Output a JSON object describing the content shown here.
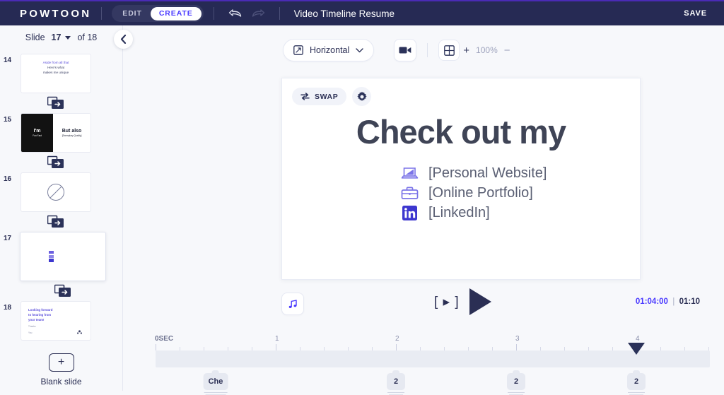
{
  "topbar": {
    "brand": "POWTOON",
    "modes": [
      {
        "label": "EDIT",
        "active": false
      },
      {
        "label": "CREATE",
        "active": true
      }
    ],
    "undo_icon": "undo-icon",
    "redo_icon": "redo-icon",
    "doc_title": "Video Timeline Resume",
    "save_label": "SAVE",
    "bg_color": "#262a54",
    "accent_color": "#4a3aff"
  },
  "sidebar": {
    "slide_label": "Slide",
    "current_slide": "17",
    "of_label": "of 18",
    "collapse_icon": "chevron-left-icon",
    "thumbs": [
      {
        "number": "14",
        "selected": false,
        "kind": "text",
        "line1": "Aside from all that",
        "line2": "Here's what",
        "line3": "makes me unique"
      },
      {
        "number": "15",
        "selected": false,
        "kind": "split",
        "left_big": "I'm",
        "left_small": "Fun Fact",
        "right_big": "But also",
        "right_small": "[Exemplary Quality]"
      },
      {
        "number": "16",
        "selected": false,
        "kind": "circle"
      },
      {
        "number": "17",
        "selected": true,
        "kind": "links",
        "marker": "[Li]"
      },
      {
        "number": "18",
        "selected": false,
        "kind": "outro",
        "head1": "Looking forward",
        "head2": "to hearing from",
        "head3": "your team!",
        "sub1": "Thanks",
        "sub2": "You"
      }
    ],
    "transition_icon": "transition-icon",
    "blank_slide": {
      "plus_icon": "plus-icon",
      "label": "Blank slide"
    }
  },
  "toolbar": {
    "orientation_icon": "resize-icon",
    "orientation_label": "Horizontal",
    "orientation_caret": "chevron-down-icon",
    "record_icon": "video-camera-icon",
    "zoom_grid_icon": "grid-icon",
    "zoom_in_label": "+",
    "zoom_level": "100%",
    "zoom_out_label": "−"
  },
  "canvas": {
    "swap_icon": "swap-arrows-icon",
    "swap_label": "SWAP",
    "settings_icon": "gear-icon",
    "title": "Check out my",
    "links": [
      {
        "icon": "laptop-icon",
        "label": "[Personal Website]"
      },
      {
        "icon": "briefcase-icon",
        "label": "[Online Portfolio]"
      },
      {
        "icon": "linkedin-icon",
        "label": "[LinkedIn]"
      }
    ]
  },
  "playback": {
    "music_icon": "music-note-icon",
    "preview_label": "[ ▸ ]",
    "play_icon": "play-icon",
    "current_time": "01:04:00",
    "divider": "|",
    "total_time": "01:10"
  },
  "timeline": {
    "ruler_labels": [
      "0SEC",
      "1",
      "2",
      "3",
      "4"
    ],
    "playhead_position_sec": 4,
    "playhead_icon": "playhead-marker",
    "clips": [
      {
        "label": "Che",
        "position_sec": 0.5
      },
      {
        "label": "2",
        "position_sec": 2.0
      },
      {
        "label": "2",
        "position_sec": 3.0
      },
      {
        "label": "2",
        "position_sec": 4.0
      }
    ]
  }
}
